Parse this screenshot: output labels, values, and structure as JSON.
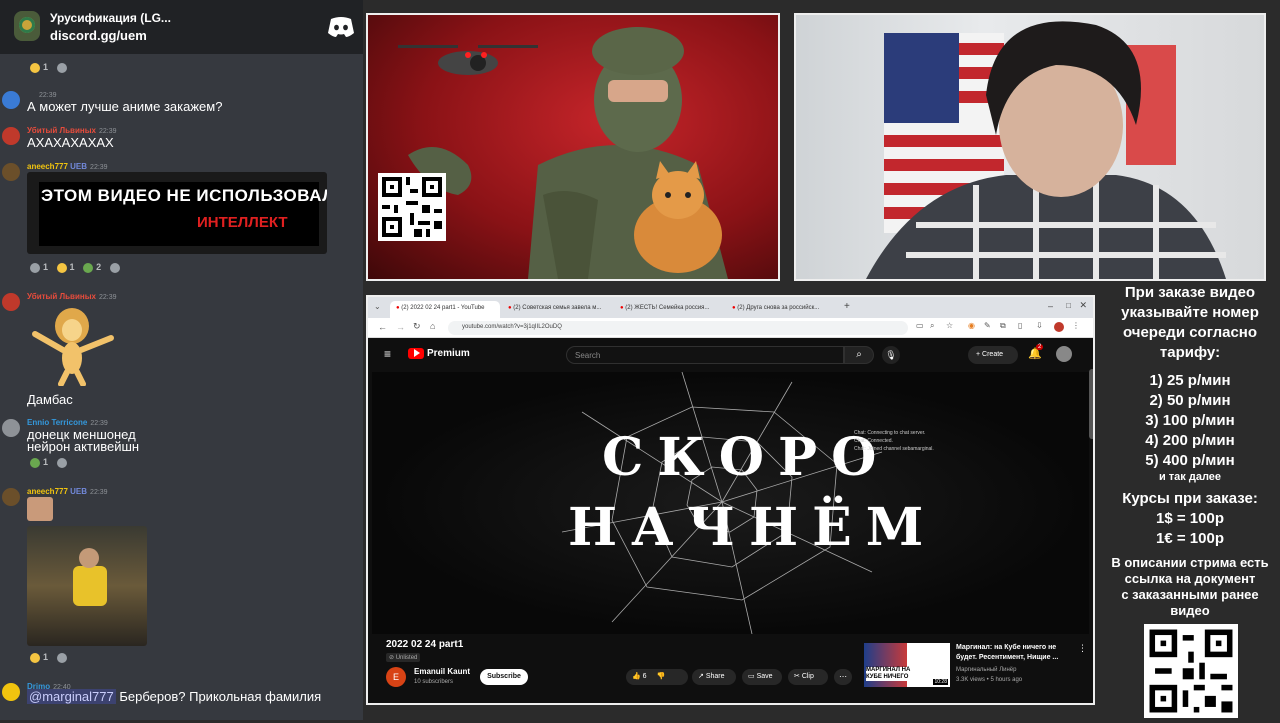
{
  "chat": {
    "server_name": "Урусификация (LG...",
    "invite": "discord.gg/uem",
    "top_reaction_count": "1",
    "messages": [
      {
        "time": "22:39",
        "text": "А может лучше аниме закажем?"
      },
      {
        "author": "Убитый Львиных",
        "time": "22:39",
        "text": "АХАХАХАХАХ"
      },
      {
        "author": "aneech777",
        "badge": "UEB",
        "time": "22:39",
        "media_line1": "ЭТОМ ВИДЕО НЕ  ИСПОЛЬЗОВАЛСЯ",
        "media_line2": "ИНТЕЛЛЕКТ",
        "reactions": [
          "1",
          "1",
          "2"
        ]
      },
      {
        "author": "Убитый Львиных",
        "time": "22:39",
        "text": "Дамбас"
      },
      {
        "author": "Ennio Terricone",
        "time": "22:39",
        "text_line1": "донецк меншонед",
        "text_line2": "нейрон активейшн",
        "reactions": [
          "1"
        ]
      },
      {
        "author": "aneech777",
        "badge": "UEB",
        "time": "22:39",
        "reactions": [
          "1"
        ]
      },
      {
        "author": "Drimo",
        "time": "22:40",
        "mention": "@marginal777",
        "text": "Берберов? Прикольная фамилия"
      }
    ]
  },
  "browser": {
    "tabs": [
      "(2) 2022 02 24 part1 - YouTube",
      "(2) Советская семья завела м...",
      "(2) ЖЕСТЬ! Семейка россия...",
      "(2) Друга снова за российск..."
    ],
    "url": "youtube.com/watch?v=3j1qIIL2OuDQ",
    "yt_brand": "Premium",
    "search_placeholder": "Search",
    "create_label": "Create",
    "notif_count": "2",
    "overlay_lines": [
      "Chat: Connecting to chat server.",
      "Chat: Connected.",
      "Chat: Joined channel  sebamarginal."
    ],
    "title_line1": "СКОРО",
    "title_line2": "НАЧНЁМ",
    "video_title": "2022 02 24 part1",
    "visibility": "Unlisted",
    "channel_name": "Emanuil Kaunt",
    "channel_subs": "10 subscribers",
    "subscribe_label": "Subscribe",
    "likes": "6",
    "share_label": "Share",
    "save_label": "Save",
    "clip_label": "Clip",
    "rec_title": "Маргинал: на Кубе ничего не будет. Ресентимент, Нищие ...",
    "rec_channel": "Маргинальный Линёр",
    "rec_meta": "3.3K views • 5 hours ago",
    "rec_duration": "10:28",
    "rec_thumb_text": "МАРГИНАЛ НА КУБЕ НИЧЕГО"
  },
  "info": {
    "l1": "При заказе видео",
    "l2": "указывайте номер",
    "l3": "очереди согласно",
    "l4": "тарифу:",
    "t1": "1) 25 р/мин",
    "t2": "2) 50 р/мин",
    "t3": "3) 100 р/мин",
    "t4": "4) 200 р/мин",
    "t5": "5) 400 р/мин",
    "etc": "и так далее",
    "rates_title": "Курсы при заказе:",
    "r1": "1$ = 100р",
    "r2": "1€ = 100р",
    "d1": "В описании стрима есть",
    "d2": "ссылка на документ",
    "d3": "с заказанными ранее",
    "d4": "видео"
  }
}
